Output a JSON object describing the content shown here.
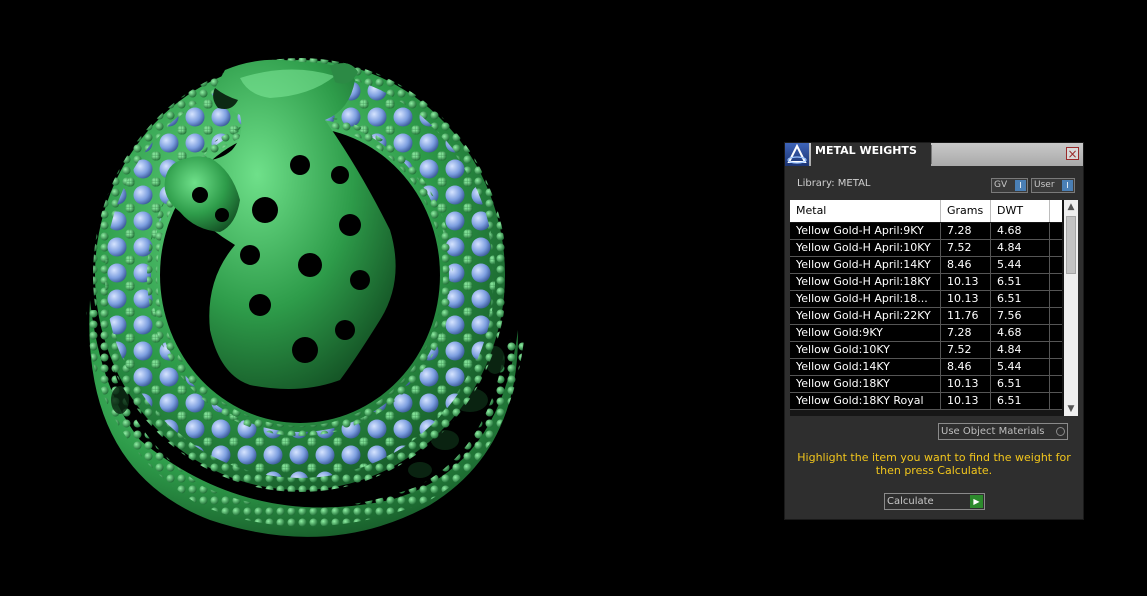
{
  "panel": {
    "title": "METAL WEIGHTS",
    "close_label": "×",
    "library_label": "Library: METAL",
    "gv_label": "GV",
    "user_label": "User",
    "knob_glyph": "I",
    "columns": [
      "Metal",
      "Grams",
      "DWT"
    ],
    "rows": [
      {
        "metal": "Yellow Gold-H April:9KY",
        "grams": "7.28",
        "dwt": "4.68"
      },
      {
        "metal": "Yellow Gold-H April:10KY",
        "grams": "7.52",
        "dwt": "4.84"
      },
      {
        "metal": "Yellow Gold-H April:14KY",
        "grams": "8.46",
        "dwt": "5.44"
      },
      {
        "metal": "Yellow Gold-H April:18KY",
        "grams": "10.13",
        "dwt": "6.51"
      },
      {
        "metal": "Yellow Gold-H April:18...",
        "grams": "10.13",
        "dwt": "6.51"
      },
      {
        "metal": "Yellow Gold-H April:22KY",
        "grams": "11.76",
        "dwt": "7.56"
      },
      {
        "metal": "Yellow Gold:9KY",
        "grams": "7.28",
        "dwt": "4.68"
      },
      {
        "metal": "Yellow Gold:10KY",
        "grams": "7.52",
        "dwt": "4.84"
      },
      {
        "metal": "Yellow Gold:14KY",
        "grams": "8.46",
        "dwt": "5.44"
      },
      {
        "metal": "Yellow Gold:18KY",
        "grams": "10.13",
        "dwt": "6.51"
      },
      {
        "metal": "Yellow Gold:18KY Royal",
        "grams": "10.13",
        "dwt": "6.51"
      }
    ],
    "use_object_materials": "Use Object Materials",
    "instructions": "Highlight the item you want to find the weight for then press Calculate.",
    "calculate_label": "Calculate",
    "scroll_up_glyph": "▲",
    "scroll_down_glyph": "▼",
    "arrow_glyph": "▶"
  },
  "colors": {
    "background": "#000000",
    "ring_green": "#3fb05a",
    "gem_blue": "#8fb0e6",
    "instruction_yellow": "#f2c61c",
    "panel_bg": "#2e2e2e"
  }
}
